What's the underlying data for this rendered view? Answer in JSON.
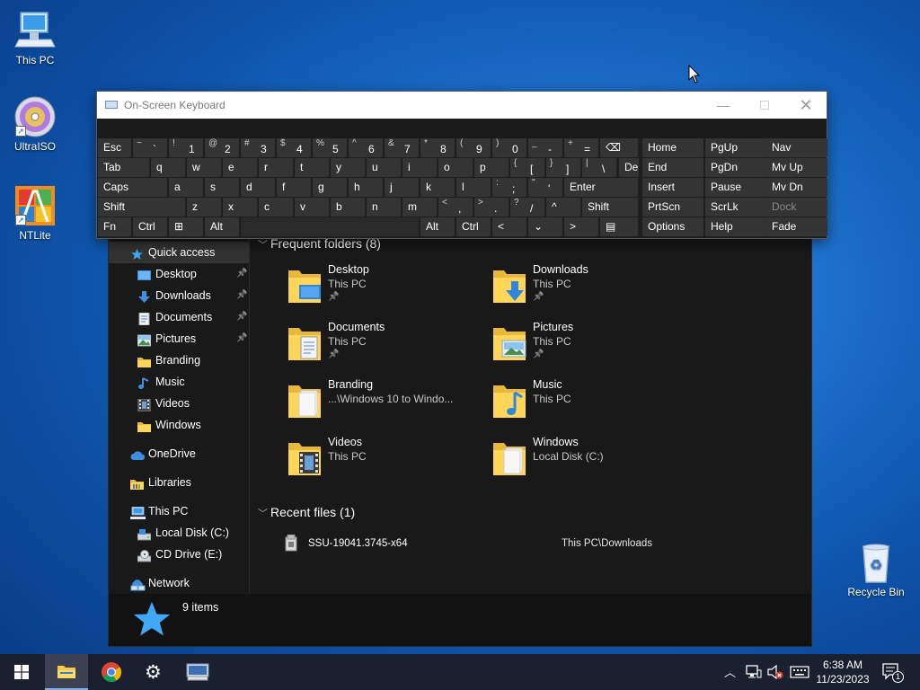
{
  "desktop": {
    "icons": [
      {
        "label": "This PC",
        "icon": "this-pc-icon"
      },
      {
        "label": "UltraISO",
        "icon": "ultraiso-icon"
      },
      {
        "label": "NTLite",
        "icon": "ntlite-icon"
      },
      {
        "label": "Recycle Bin",
        "icon": "recycle-bin-icon"
      }
    ]
  },
  "osk": {
    "title": "On-Screen Keyboard",
    "rows": [
      [
        {
          "main": "Esc"
        },
        {
          "top": "~",
          "bot": "`"
        },
        {
          "top": "!",
          "bot": "1"
        },
        {
          "top": "@",
          "bot": "2"
        },
        {
          "top": "#",
          "bot": "3"
        },
        {
          "top": "$",
          "bot": "4"
        },
        {
          "top": "%",
          "bot": "5"
        },
        {
          "top": "^",
          "bot": "6"
        },
        {
          "top": "&",
          "bot": "7"
        },
        {
          "top": "*",
          "bot": "8"
        },
        {
          "top": "(",
          "bot": "9"
        },
        {
          "top": ")",
          "bot": "0"
        },
        {
          "top": "_",
          "bot": "-"
        },
        {
          "top": "+",
          "bot": "="
        },
        {
          "main": "⌫"
        },
        {
          "main": "Home"
        },
        {
          "main": "PgUp"
        },
        {
          "main": "Nav"
        }
      ],
      [
        {
          "main": "Tab"
        },
        {
          "main": "q"
        },
        {
          "main": "w"
        },
        {
          "main": "e"
        },
        {
          "main": "r"
        },
        {
          "main": "t"
        },
        {
          "main": "y"
        },
        {
          "main": "u"
        },
        {
          "main": "i"
        },
        {
          "main": "o"
        },
        {
          "main": "p"
        },
        {
          "top": "{",
          "bot": "["
        },
        {
          "top": "}",
          "bot": "]"
        },
        {
          "top": "|",
          "bot": "\\"
        },
        {
          "main": "Del"
        },
        {
          "main": "End"
        },
        {
          "main": "PgDn"
        },
        {
          "main": "Mv Up"
        }
      ],
      [
        {
          "main": "Caps"
        },
        {
          "main": "a"
        },
        {
          "main": "s"
        },
        {
          "main": "d"
        },
        {
          "main": "f"
        },
        {
          "main": "g"
        },
        {
          "main": "h"
        },
        {
          "main": "j"
        },
        {
          "main": "k"
        },
        {
          "main": "l"
        },
        {
          "top": ":",
          "bot": ";"
        },
        {
          "top": "\"",
          "bot": "'"
        },
        {
          "main": "Enter"
        },
        {
          "main": "Insert"
        },
        {
          "main": "Pause"
        },
        {
          "main": "Mv Dn"
        }
      ],
      [
        {
          "main": "Shift"
        },
        {
          "main": "z"
        },
        {
          "main": "x"
        },
        {
          "main": "c"
        },
        {
          "main": "v"
        },
        {
          "main": "b"
        },
        {
          "main": "n"
        },
        {
          "main": "m"
        },
        {
          "top": "<",
          "bot": ","
        },
        {
          "top": ">",
          "bot": "."
        },
        {
          "top": "?",
          "bot": "/"
        },
        {
          "main": "^"
        },
        {
          "main": "Shift"
        },
        {
          "main": "PrtScn"
        },
        {
          "main": "ScrLk"
        },
        {
          "main": "Dock",
          "dim": true
        }
      ],
      [
        {
          "main": "Fn"
        },
        {
          "main": "Ctrl"
        },
        {
          "main": "⊞"
        },
        {
          "main": "Alt"
        },
        {
          "main": ""
        },
        {
          "main": "Alt"
        },
        {
          "main": "Ctrl"
        },
        {
          "main": "<"
        },
        {
          "main": "⌄"
        },
        {
          "main": ">"
        },
        {
          "main": "▤"
        },
        {
          "main": "Options"
        },
        {
          "main": "Help"
        },
        {
          "main": "Fade"
        }
      ]
    ]
  },
  "explorer": {
    "nav": [
      {
        "label": "Quick access",
        "icon": "star-icon",
        "indent": 1,
        "selected": true,
        "pinned": false
      },
      {
        "label": "Desktop",
        "icon": "desktop-folder-icon",
        "indent": 2,
        "pinned": true
      },
      {
        "label": "Downloads",
        "icon": "download-arrow-icon",
        "indent": 2,
        "pinned": true
      },
      {
        "label": "Documents",
        "icon": "documents-icon",
        "indent": 2,
        "pinned": true
      },
      {
        "label": "Pictures",
        "icon": "pictures-icon",
        "indent": 2,
        "pinned": true
      },
      {
        "label": "Branding",
        "icon": "folder-icon",
        "indent": 2,
        "pinned": false
      },
      {
        "label": "Music",
        "icon": "music-note-icon",
        "indent": 2,
        "pinned": false
      },
      {
        "label": "Videos",
        "icon": "videos-icon",
        "indent": 2,
        "pinned": false
      },
      {
        "label": "Windows",
        "icon": "folder-icon",
        "indent": 2,
        "pinned": false
      },
      {
        "gap": true
      },
      {
        "label": "OneDrive",
        "icon": "cloud-icon",
        "indent": 1,
        "pinned": false
      },
      {
        "gap": true
      },
      {
        "label": "Libraries",
        "icon": "libraries-icon",
        "indent": 1,
        "pinned": false
      },
      {
        "gap": true
      },
      {
        "label": "This PC",
        "icon": "computer-icon",
        "indent": 1,
        "pinned": false
      },
      {
        "label": "Local Disk (C:)",
        "icon": "drive-icon",
        "indent": 2,
        "pinned": false
      },
      {
        "label": "CD Drive (E:)",
        "icon": "cd-drive-icon",
        "indent": 2,
        "pinned": false
      },
      {
        "gap": true
      },
      {
        "label": "Network",
        "icon": "network-icon",
        "indent": 1,
        "pinned": false
      }
    ],
    "frequent_header": "Frequent folders (8)",
    "folders": [
      {
        "name": "Desktop",
        "location": "This PC",
        "pinned": true,
        "icon": "desktop-folder-icon"
      },
      {
        "name": "Downloads",
        "location": "This PC",
        "pinned": true,
        "icon": "downloads-folder-icon"
      },
      {
        "name": "Documents",
        "location": "This PC",
        "pinned": true,
        "icon": "documents-folder-icon"
      },
      {
        "name": "Pictures",
        "location": "This PC",
        "pinned": true,
        "icon": "pictures-folder-icon"
      },
      {
        "name": "Branding",
        "location": "...\\Windows 10 to Windo...",
        "pinned": false,
        "icon": "folder-icon"
      },
      {
        "name": "Music",
        "location": "This PC",
        "pinned": false,
        "icon": "music-folder-icon"
      },
      {
        "name": "Videos",
        "location": "This PC",
        "pinned": false,
        "icon": "videos-folder-icon"
      },
      {
        "name": "Windows",
        "location": "Local Disk (C:)",
        "pinned": false,
        "icon": "folder-icon"
      }
    ],
    "recent_header": "Recent files (1)",
    "recent_files": [
      {
        "name": "SSU-19041.3745-x64",
        "path": "This PC\\Downloads"
      }
    ],
    "status": {
      "items": "9 items"
    }
  },
  "taskbar": {
    "time": "6:38 AM",
    "date": "11/23/2023",
    "notification_count": "1",
    "apps": [
      {
        "name": "start-button",
        "icon": "windows-logo-icon"
      },
      {
        "name": "file-explorer-button",
        "icon": "folder-icon",
        "active": true
      },
      {
        "name": "chrome-button",
        "icon": "chrome-icon"
      },
      {
        "name": "settings-button",
        "icon": "gear-icon"
      },
      {
        "name": "on-screen-keyboard-button",
        "icon": "keyboard-icon"
      }
    ]
  },
  "colors": {
    "accent": "#0078d7",
    "explorer_bg": "#191919",
    "key_bg": "#343434",
    "taskbar_bg": "#1b2030"
  }
}
